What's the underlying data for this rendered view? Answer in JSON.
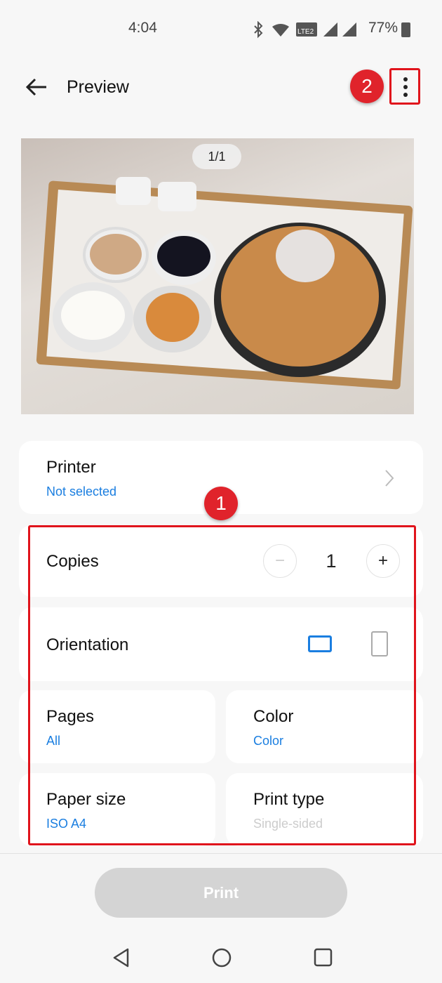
{
  "status_bar": {
    "time": "4:04",
    "battery": "77%",
    "icons": [
      "bluetooth-icon",
      "wifi-icon",
      "volte2-icon",
      "signal-roaming-icon",
      "signal-icon",
      "battery-charging-icon"
    ]
  },
  "header": {
    "title": "Preview",
    "back_icon": "arrow-left-icon",
    "menu_icon": "more-vertical-icon"
  },
  "preview": {
    "page_indicator": "1/1"
  },
  "printer": {
    "label": "Printer",
    "value": "Not selected"
  },
  "copies": {
    "label": "Copies",
    "value": "1",
    "minus": "−",
    "plus": "+"
  },
  "orientation": {
    "label": "Orientation",
    "selected": "landscape"
  },
  "pages": {
    "label": "Pages",
    "value": "All"
  },
  "color": {
    "label": "Color",
    "value": "Color"
  },
  "paper_size": {
    "label": "Paper size",
    "value": "ISO A4"
  },
  "print_type": {
    "label": "Print type",
    "value": "Single-sided"
  },
  "print_button": "Print",
  "annotations": {
    "badge1": "1",
    "badge2": "2",
    "color": "#e0141c"
  },
  "colors": {
    "accent": "#1a7ee0",
    "disabled": "#d4d4d4"
  }
}
